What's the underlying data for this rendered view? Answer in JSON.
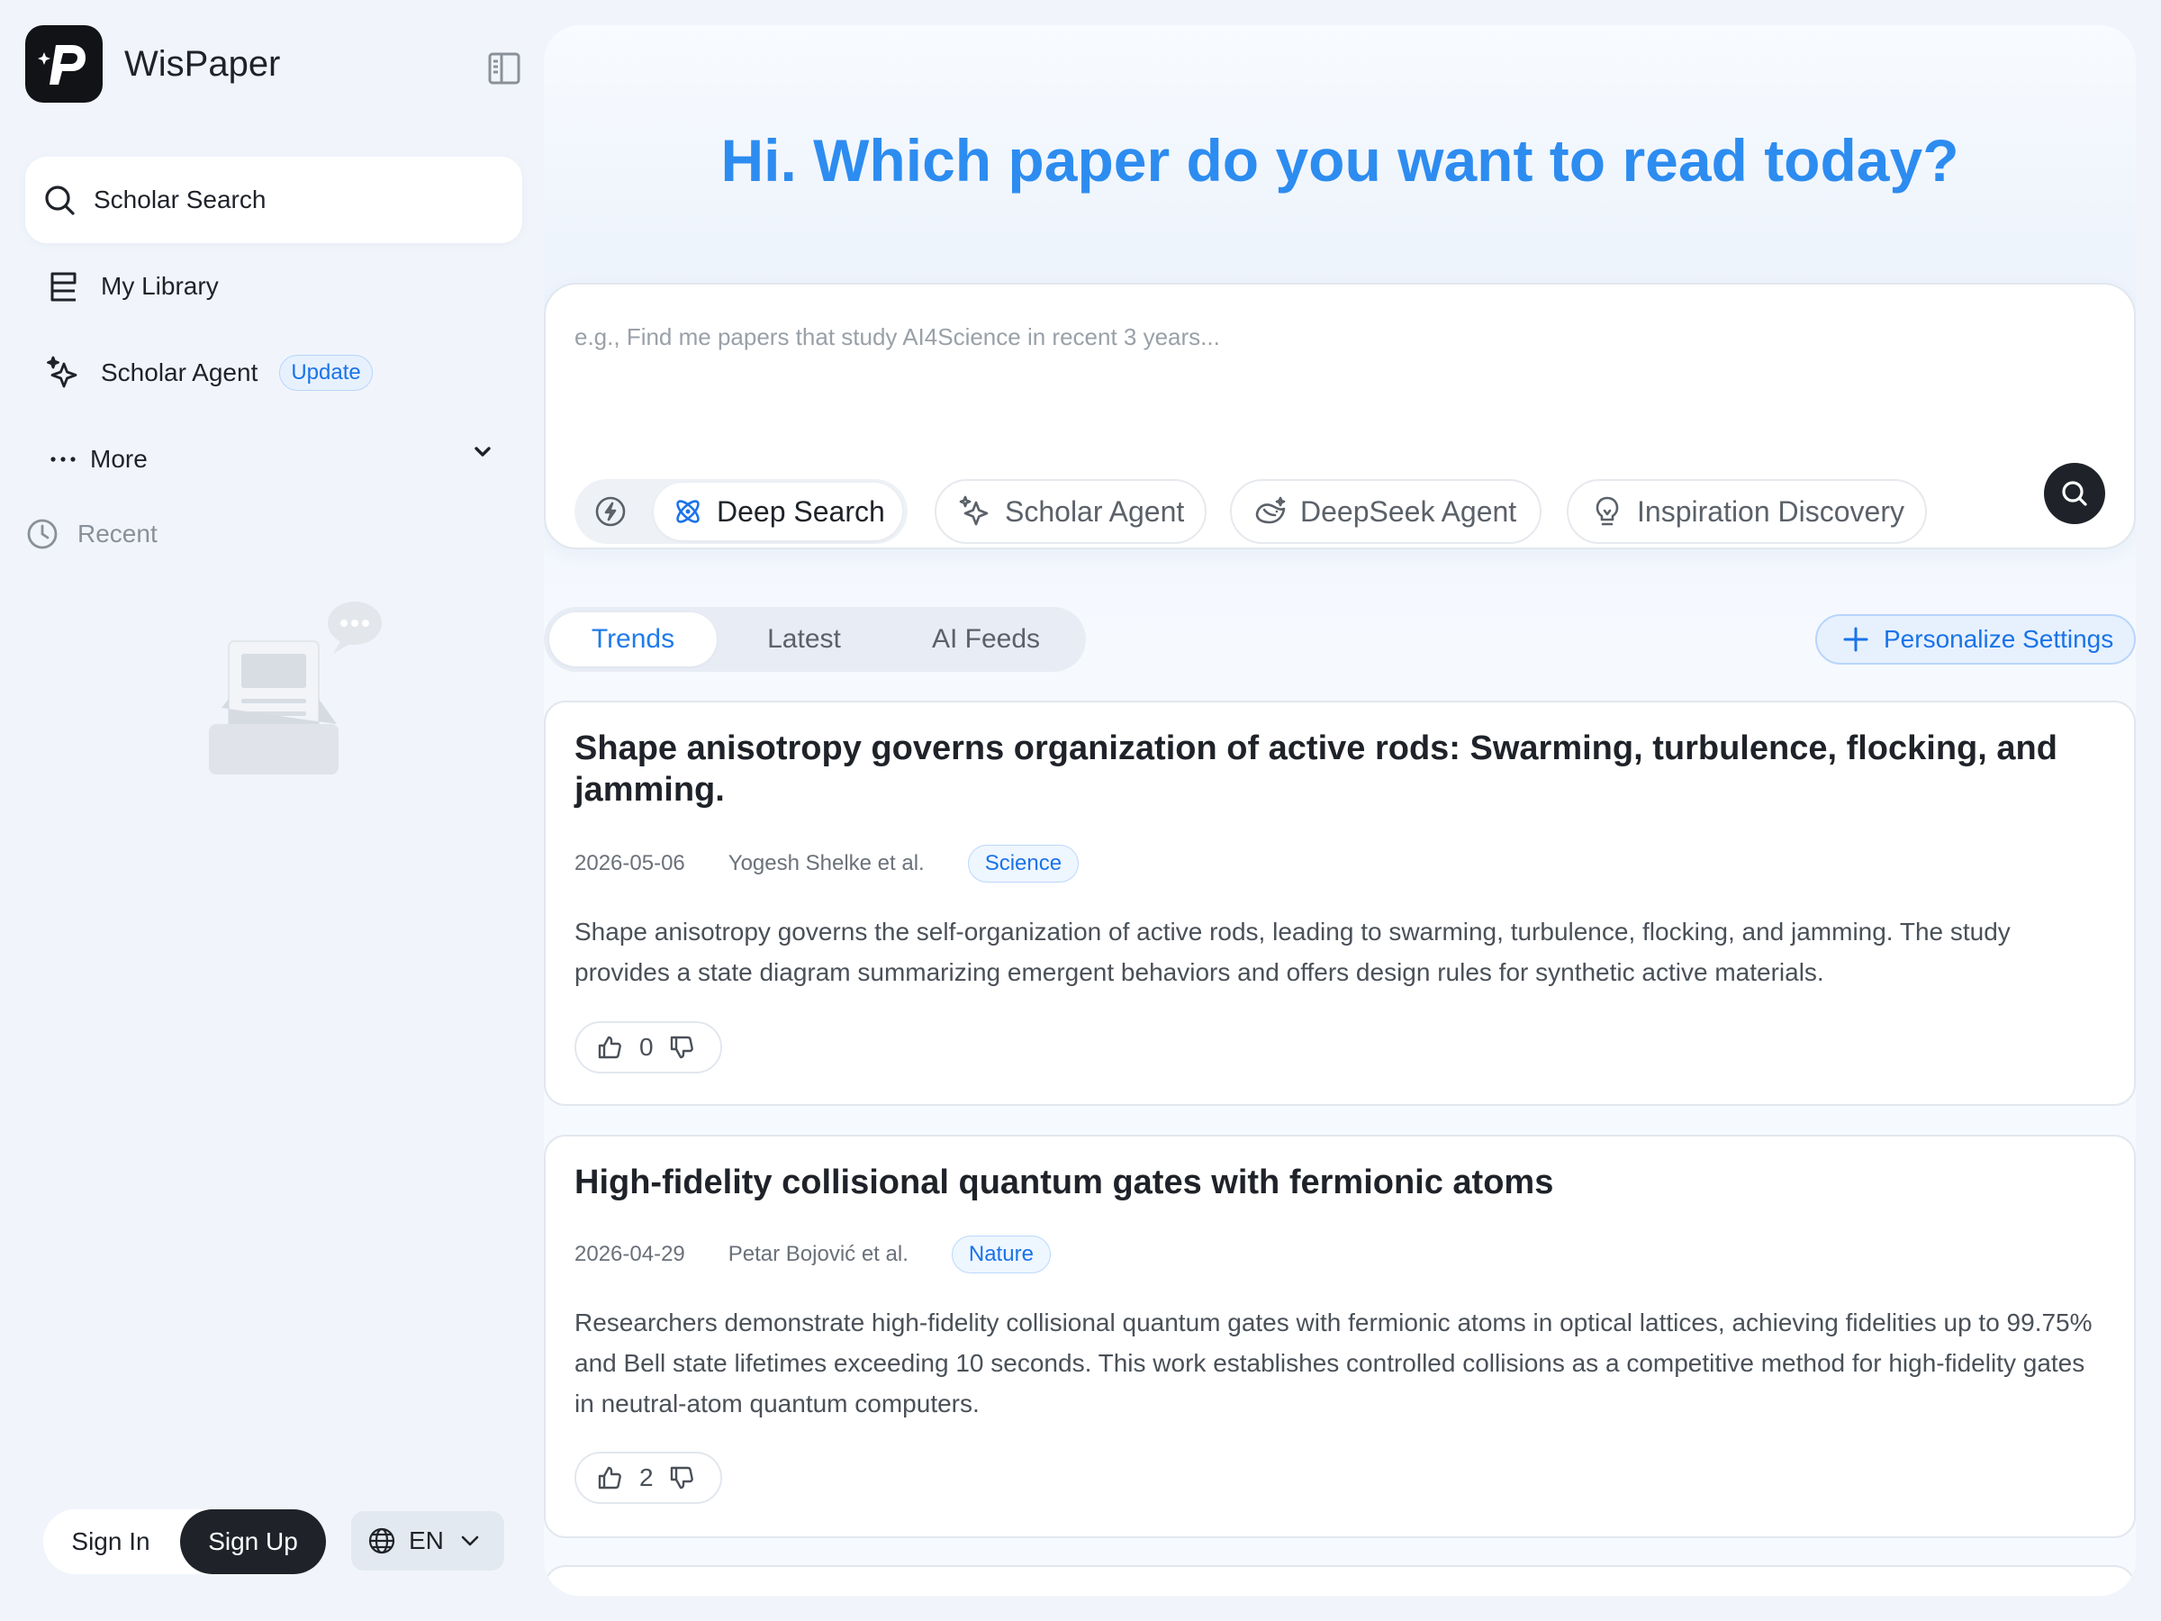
{
  "app": {
    "name": "WisPaper"
  },
  "sidebar": {
    "items": [
      {
        "label": "Scholar Search"
      },
      {
        "label": "My Library"
      },
      {
        "label": "Scholar Agent",
        "badge": "Update"
      },
      {
        "label": "More"
      }
    ],
    "recent_label": "Recent"
  },
  "auth": {
    "sign_in": "Sign In",
    "sign_up": "Sign Up"
  },
  "language": {
    "label": "EN"
  },
  "hero": {
    "title": "Hi. Which paper do you want to read today?"
  },
  "search": {
    "placeholder": "e.g., Find me papers that study AI4Science in recent 3 years...",
    "modes": [
      {
        "label": "Deep Search"
      },
      {
        "label": "Scholar Agent"
      },
      {
        "label": "DeepSeek Agent"
      },
      {
        "label": "Inspiration Discovery"
      }
    ]
  },
  "feed": {
    "tabs": [
      {
        "label": "Trends"
      },
      {
        "label": "Latest"
      },
      {
        "label": "AI Feeds"
      }
    ],
    "active_tab": "Trends",
    "personalize_label": "Personalize Settings",
    "papers": [
      {
        "title": "Shape anisotropy governs organization of active rods: Swarming, turbulence, flocking, and jamming.",
        "date": "2026-05-06",
        "authors": "Yogesh Shelke et al.",
        "journal": "Science",
        "summary": "Shape anisotropy governs the self-organization of active rods, leading to swarming, turbulence, flocking, and jamming. The study provides a state diagram summarizing emergent behaviors and offers design rules for synthetic active materials.",
        "likes": "0"
      },
      {
        "title": "High-fidelity collisional quantum gates with fermionic atoms",
        "date": "2026-04-29",
        "authors": "Petar Bojović et al.",
        "journal": "Nature",
        "summary": "Researchers demonstrate high-fidelity collisional quantum gates with fermionic atoms in optical lattices, achieving fidelities up to 99.75% and Bell state lifetimes exceeding 10 seconds. This work establishes controlled collisions as a competitive method for high-fidelity gates in neutral-atom quantum computers.",
        "likes": "2"
      }
    ]
  },
  "colors": {
    "accent": "#2d8cf0",
    "link_blue": "#1a73e8",
    "dark": "#1f2329",
    "page_bg": "#f1f5fb"
  }
}
